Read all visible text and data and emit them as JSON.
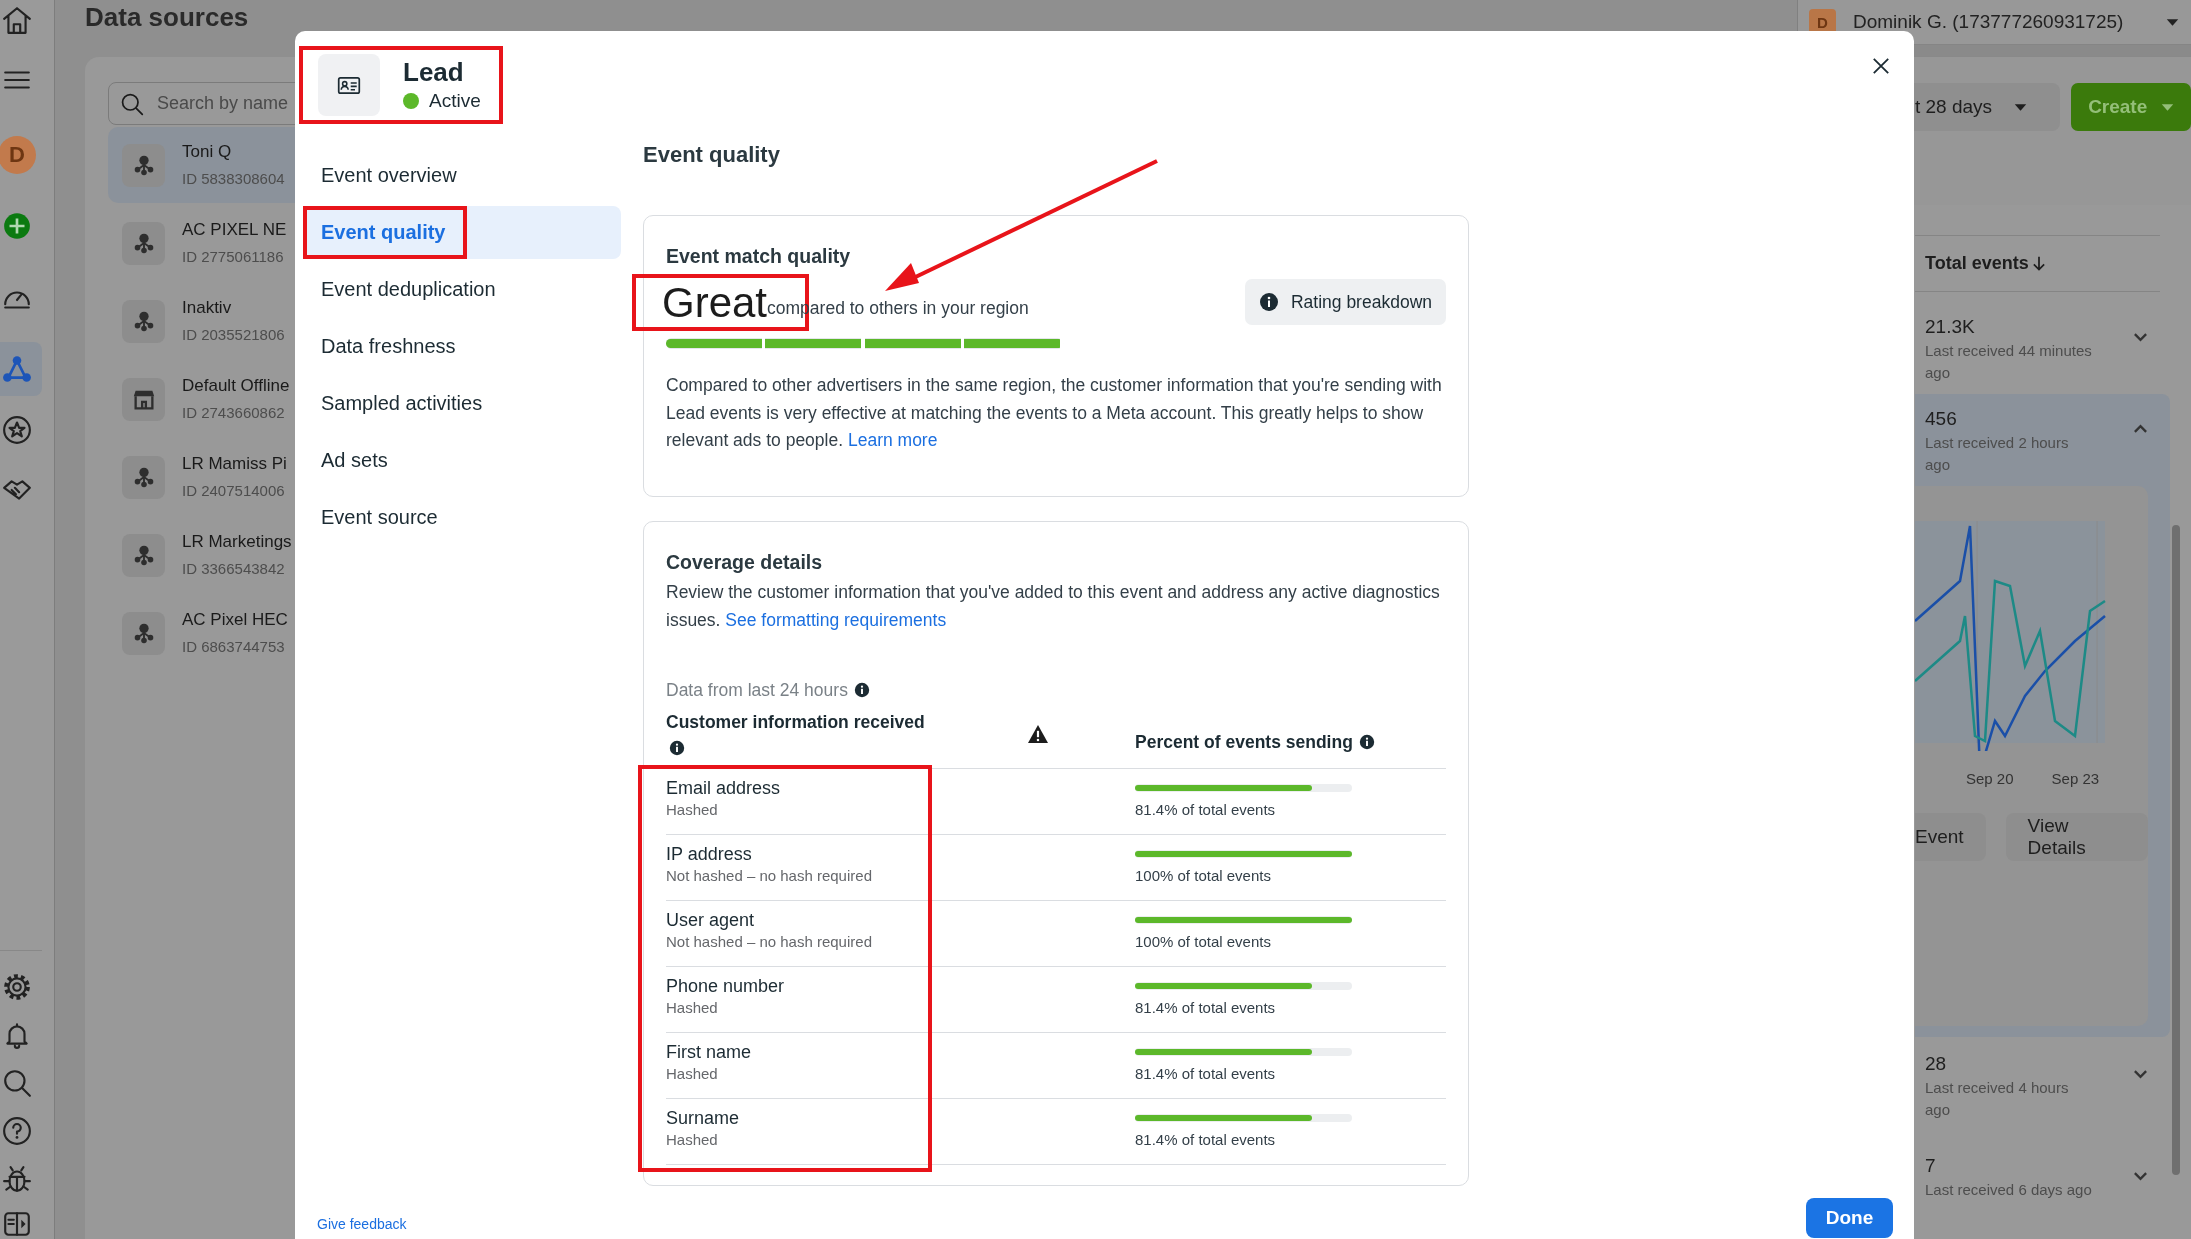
{
  "rail": {
    "top": [
      {
        "kind": "home",
        "selected": false
      },
      {
        "kind": "menu",
        "selected": false
      },
      {
        "kind": "avatar",
        "letter": "D",
        "selected": false
      },
      {
        "kind": "add",
        "selected": false
      },
      {
        "kind": "gauge",
        "selected": false
      },
      {
        "kind": "network",
        "selected": true
      },
      {
        "kind": "star",
        "selected": false
      },
      {
        "kind": "handshake",
        "selected": false
      }
    ],
    "bottom": [
      {
        "kind": "settings",
        "selected": false
      },
      {
        "kind": "bell",
        "selected": false
      },
      {
        "kind": "search",
        "selected": false
      },
      {
        "kind": "help",
        "selected": false
      },
      {
        "kind": "bug",
        "selected": false
      },
      {
        "kind": "sidebar",
        "selected": false
      }
    ]
  },
  "page_title": "Data sources",
  "source_list": {
    "search_placeholder": "Search by name",
    "items": [
      {
        "name": "Toni Q",
        "id": "ID 5838308604",
        "kind": "pixel",
        "selected": true
      },
      {
        "name": "AC PIXEL NE",
        "id": "ID 2775061186",
        "kind": "pixel",
        "selected": false
      },
      {
        "name": "Inaktiv",
        "id": "ID 2035521806",
        "kind": "pixel",
        "selected": false
      },
      {
        "name": "Default Offline",
        "id": "ID 2743660862",
        "kind": "store",
        "selected": false
      },
      {
        "name": "LR Mamiss Pi",
        "id": "ID 2407514006",
        "kind": "pixel",
        "selected": false
      },
      {
        "name": "LR Marketings",
        "id": "ID 3366543842",
        "kind": "pixel",
        "selected": false
      },
      {
        "name": "AC Pixel HEC",
        "id": "ID 6863744753",
        "kind": "pixel",
        "selected": false
      }
    ]
  },
  "account": {
    "avatar_letter": "D",
    "name": "Dominik G. (173777260931725)"
  },
  "toolbar": {
    "date_range": "t 28 days",
    "create": "Create"
  },
  "events_column": {
    "heading": "Total events",
    "rows": [
      {
        "count": "21.3K",
        "last_received": "Last received 44 minutes ago",
        "expanded": false
      },
      {
        "count": "456",
        "last_received": "Last received 2 hours ago",
        "expanded": true,
        "x_labels": [
          "Sep 20",
          "Sep 23"
        ],
        "buttons": [
          "Event",
          "View Details"
        ]
      },
      {
        "count": "28",
        "last_received": "Last received 4 hours ago",
        "expanded": false
      },
      {
        "count": "7",
        "last_received": "Last received 6 days ago",
        "expanded": false
      }
    ]
  },
  "modal": {
    "header": {
      "title": "Lead",
      "status": "Active",
      "active": true,
      "highlighted": true
    },
    "nav": [
      {
        "label": "Event overview",
        "selected": false,
        "highlighted": false
      },
      {
        "label": "Event quality",
        "selected": true,
        "highlighted": true
      },
      {
        "label": "Event deduplication",
        "selected": false,
        "highlighted": false
      },
      {
        "label": "Data freshness",
        "selected": false,
        "highlighted": false
      },
      {
        "label": "Sampled activities",
        "selected": false,
        "highlighted": false
      },
      {
        "label": "Ad sets",
        "selected": false,
        "highlighted": false
      },
      {
        "label": "Event source",
        "selected": false,
        "highlighted": false
      }
    ],
    "section_title": "Event quality",
    "match_quality": {
      "heading": "Event match quality",
      "rating": "Great",
      "rating_highlighted": true,
      "arrow": true,
      "rating_note": "compared to others in your region",
      "level": 1,
      "breakdown_button": "Rating breakdown",
      "description": "Compared to other advertisers in the same region, the customer information that you're sending with Lead events is very effective at matching the events to a Meta account. This greatly helps to show relevant ads to people.",
      "link": "Learn more"
    },
    "coverage": {
      "heading": "Coverage details",
      "description": "Review the customer information that you've added to this event and address any active diagnostics issues.",
      "link": "See formatting requirements",
      "data_note": "Data from last 24 hours",
      "columns": [
        "Customer information received",
        "Percent of events sending"
      ],
      "highlighted": true,
      "rows": [
        {
          "name": "Email address",
          "hashing": "Hashed",
          "level": 0.814,
          "reading": "81.4% of total events"
        },
        {
          "name": "IP address",
          "hashing": "Not hashed – no hash required",
          "level": 1,
          "reading": "100% of total events"
        },
        {
          "name": "User agent",
          "hashing": "Not hashed – no hash required",
          "level": 1,
          "reading": "100% of total events"
        },
        {
          "name": "Phone number",
          "hashing": "Hashed",
          "level": 0.814,
          "reading": "81.4% of total events"
        },
        {
          "name": "First name",
          "hashing": "Hashed",
          "level": 0.814,
          "reading": "81.4% of total events"
        },
        {
          "name": "Surname",
          "hashing": "Hashed",
          "level": 0.814,
          "reading": "81.4% of total events"
        }
      ]
    },
    "footer": {
      "feedback": "Give feedback",
      "done": "Done"
    }
  }
}
